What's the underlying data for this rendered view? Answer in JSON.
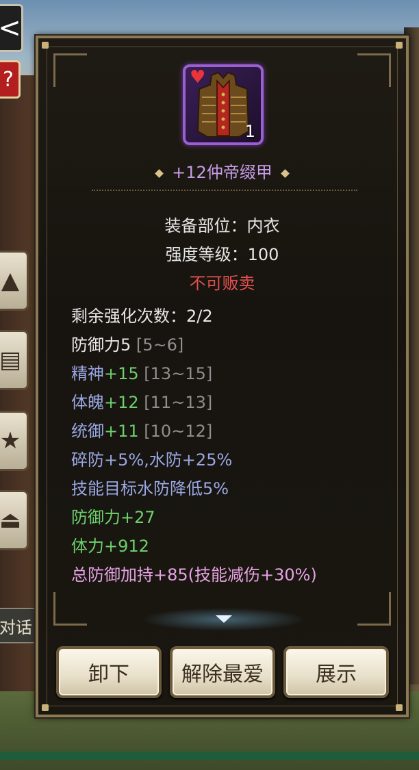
{
  "item": {
    "name": "+12仲帝缀甲",
    "count": "1",
    "slot_line": "装备部位：内衣",
    "strength_line": "强度等级：100",
    "sell_status": "不可贩卖"
  },
  "stats": {
    "remaining_upgrades": "剩余强化次数：2/2",
    "defense_base": "防御力5",
    "defense_range": "[5~6]",
    "spirit_label": "精神",
    "spirit_value": "+15",
    "spirit_range": "[13~15]",
    "physique_label": "体魄",
    "physique_value": "+12",
    "physique_range": "[11~13]",
    "command_label": "统御",
    "command_value": "+11",
    "command_range": "[10~12]",
    "resist_line": "碎防+5%,水防+25%",
    "skill_line": "技能目标水防降低5%",
    "bonus_defense": "防御力+27",
    "bonus_stamina": "体力+912",
    "total_defense": "总防御加持+85(技能减伤+30%)"
  },
  "buttons": {
    "unequip": "卸下",
    "unfavorite": "解除最爱",
    "showcase": "展示"
  },
  "side": {
    "back_glyph": "<",
    "help_glyph": "?",
    "talk_label": "对话"
  },
  "colors": {
    "item_name": "#c89ce8",
    "attribute_blue": "#9aa8e4",
    "bonus_green": "#6dd06d",
    "total_pink": "#e6a3e3",
    "unsellable_red": "#e25050"
  },
  "icons": {
    "item": "armor-vest-icon",
    "favorite": "heart-icon",
    "scroll": "chevron-down-icon"
  }
}
